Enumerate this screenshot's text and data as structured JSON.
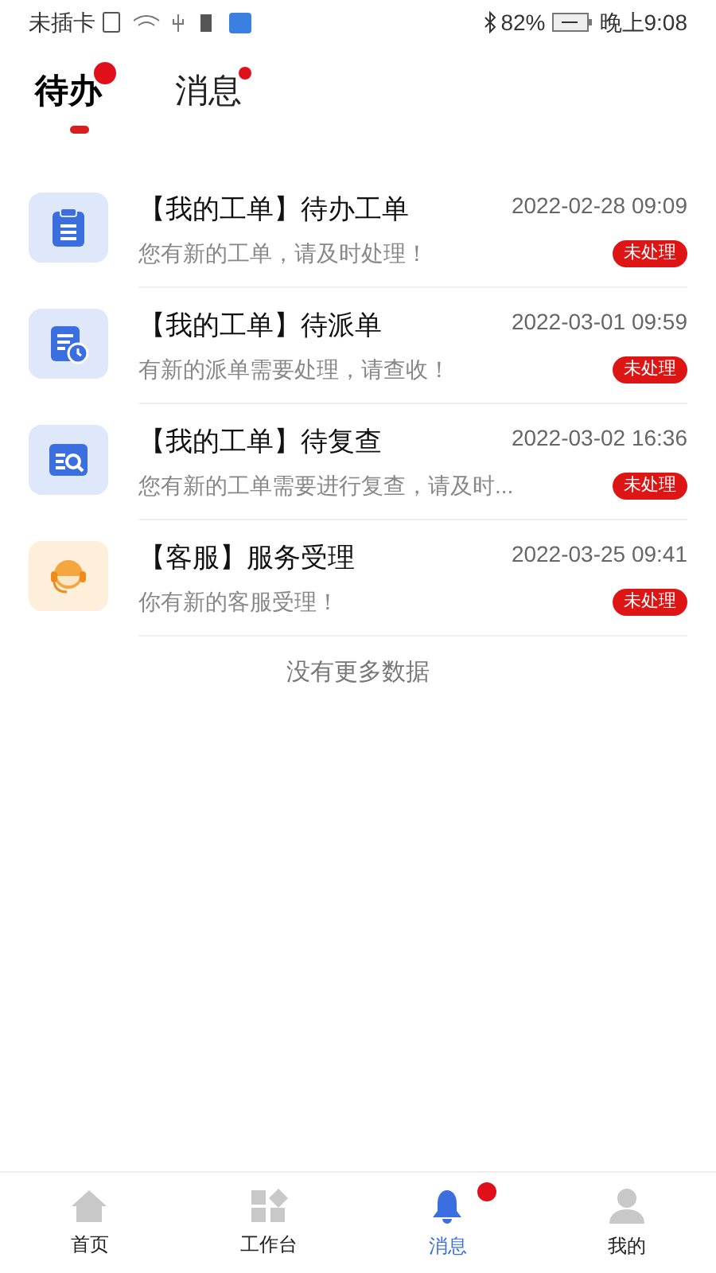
{
  "status_bar": {
    "carrier": "未插卡",
    "battery": "82%",
    "time": "晚上9:08"
  },
  "tabs": [
    {
      "label": "待办",
      "selected": true,
      "dot": true
    },
    {
      "label": "消息",
      "selected": false,
      "dot": true
    }
  ],
  "items": [
    {
      "kind": "clipboard",
      "title": "【我的工单】待办工单",
      "time": "2022-02-28 09:09",
      "text": "您有新的工单，请及时处理！",
      "status": "未处理"
    },
    {
      "kind": "dispatch",
      "title": "【我的工单】待派单",
      "time": "2022-03-01 09:59",
      "text": "有新的派单需要处理，请查收！",
      "status": "未处理"
    },
    {
      "kind": "review",
      "title": "【我的工单】待复查",
      "time": "2022-03-02 16:36",
      "text": "您有新的工单需要进行复查，请及时...",
      "status": "未处理"
    },
    {
      "kind": "service",
      "title": "【客服】服务受理",
      "time": "2022-03-25 09:41",
      "text": "你有新的客服受理！",
      "status": "未处理"
    }
  ],
  "footer_note": "没有更多数据",
  "nav": [
    {
      "kind": "home",
      "label": "首页",
      "selected": false,
      "badge": false
    },
    {
      "kind": "grid",
      "label": "工作台",
      "selected": false,
      "badge": false
    },
    {
      "kind": "bell",
      "label": "消息",
      "selected": true,
      "badge": true
    },
    {
      "kind": "person",
      "label": "我的",
      "selected": false,
      "badge": false
    }
  ]
}
